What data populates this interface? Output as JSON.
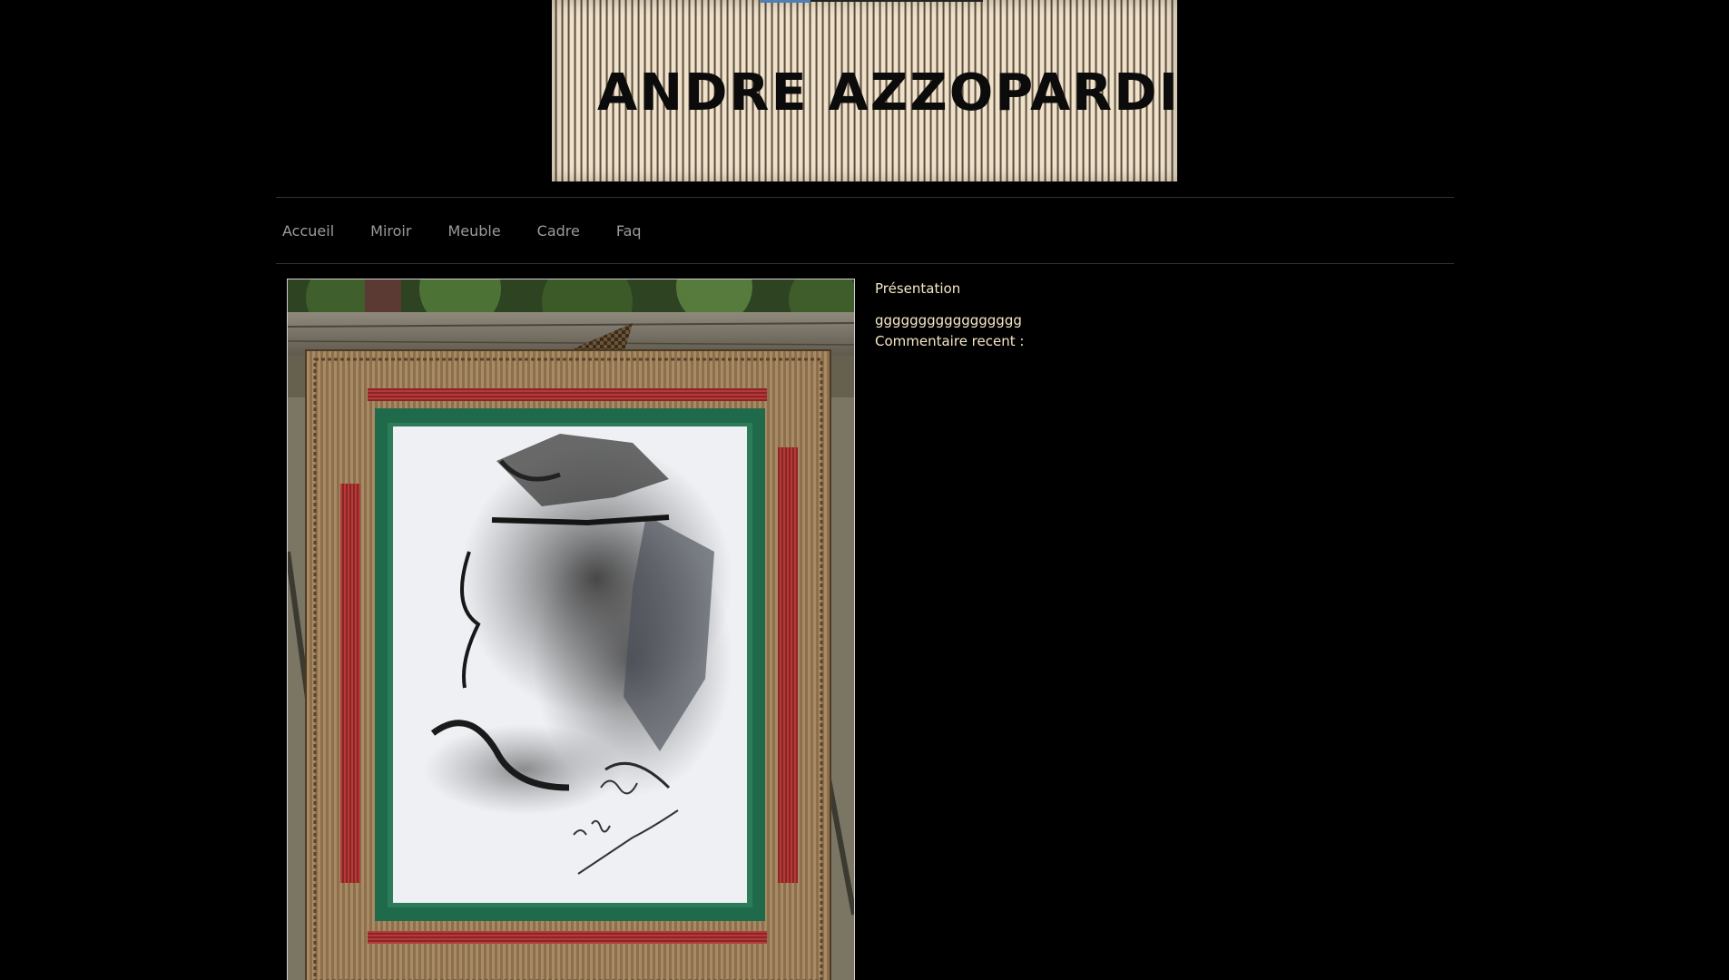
{
  "banner": {
    "title": "ANDRE AZZOPARDI"
  },
  "nav": {
    "items": [
      {
        "label": "Accueil"
      },
      {
        "label": "Miroir"
      },
      {
        "label": "Meuble"
      },
      {
        "label": "Cadre"
      },
      {
        "label": "Faq"
      }
    ]
  },
  "sidebar": {
    "section_title": "Présentation",
    "presentation_text": "ggggggggggggggggg",
    "recent_comments_label": "Commentaire recent :"
  },
  "colors": {
    "background": "#000000",
    "nav_text": "#9b9b9b",
    "sidebar_text": "#f6e8c6"
  }
}
